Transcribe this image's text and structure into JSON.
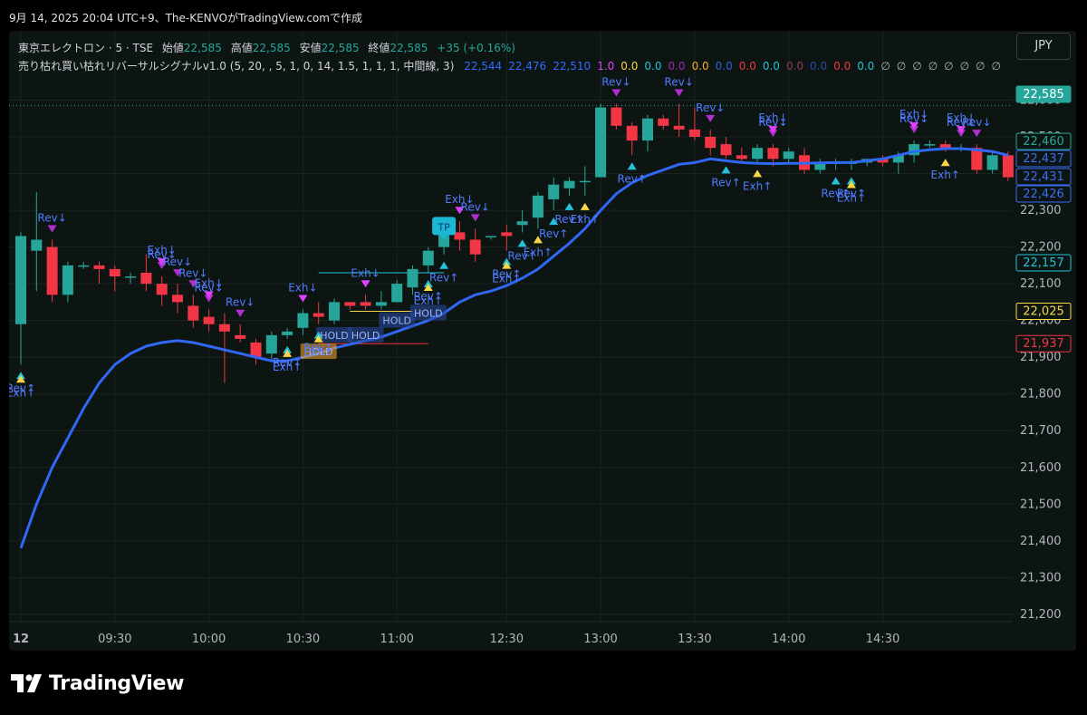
{
  "snapshot_line": "9月 14, 2025 20:04 UTC+9、The-KENVOがTradingView.comで作成",
  "currency_button": "JPY",
  "legend": {
    "symbol": "東京エレクトロン · 5 · TSE",
    "open_label": "始値",
    "open_value": "22,585",
    "high_label": "高値",
    "high_value": "22,585",
    "low_label": "安値",
    "low_value": "22,585",
    "close_label": "終値",
    "close_value": "22,585",
    "change": "+35 (+0.16%)",
    "indicator_name": "売り枯れ買い枯れリバーサルシグナルv1.0 (5, 20, , 5, 1, 0, 14, 1.5, 1, 1, 1, 中間線, 3)",
    "indicator_values": [
      {
        "text": "22,544",
        "color": "#2f6bff"
      },
      {
        "text": "22,476",
        "color": "#2f6bff"
      },
      {
        "text": "22,510",
        "color": "#2f6bff"
      },
      {
        "text": "1.0",
        "color": "#e040fb"
      },
      {
        "text": "0.0",
        "color": "#f9d648"
      },
      {
        "text": "0.0",
        "color": "#22c3d6"
      },
      {
        "text": "0.0",
        "color": "#9c27b0"
      },
      {
        "text": "0.0",
        "color": "#ffa726"
      },
      {
        "text": "0.0",
        "color": "#2f5fd8"
      },
      {
        "text": "0.0",
        "color": "#f23645"
      },
      {
        "text": "0.0",
        "color": "#22c3d6"
      },
      {
        "text": "0.0",
        "color": "#8e3a5a"
      },
      {
        "text": "0.0",
        "color": "#2a4aa0"
      },
      {
        "text": "0.0",
        "color": "#f23645"
      },
      {
        "text": "0.0",
        "color": "#22c3d6"
      },
      {
        "text": "∅",
        "color": "#b2b5be"
      },
      {
        "text": "∅",
        "color": "#b2b5be"
      },
      {
        "text": "∅",
        "color": "#b2b5be"
      },
      {
        "text": "∅",
        "color": "#b2b5be"
      },
      {
        "text": "∅",
        "color": "#b2b5be"
      },
      {
        "text": "∅",
        "color": "#b2b5be"
      },
      {
        "text": "∅",
        "color": "#b2b5be"
      },
      {
        "text": "∅",
        "color": "#b2b5be"
      }
    ]
  },
  "footer_brand": "TradingView",
  "colors": {
    "up": "#26a69a",
    "down": "#f23645",
    "ma_line": "#3068f5",
    "background": "#0d1513",
    "grid": "#1b2421",
    "signal_up": "#22c3d6",
    "signal_down": "#b02fd0",
    "signal_exh_up": "#f9d648",
    "signal_exh_down": "#e040fb",
    "label_text": "#4f7cff"
  },
  "chart_data": {
    "type": "candlestick",
    "symbol": "東京エレクトロン",
    "interval": "5",
    "x_tick_labels": [
      "12",
      "09:30",
      "10:00",
      "10:30",
      "11:00",
      "12:30",
      "13:00",
      "13:30",
      "14:00",
      "14:30"
    ],
    "x_tick_index": [
      0,
      6,
      12,
      18,
      24,
      31,
      37,
      43,
      49,
      55
    ],
    "y_ticks": [
      21200,
      21300,
      21400,
      21500,
      21600,
      21700,
      21800,
      21900,
      22000,
      22100,
      22200,
      22300,
      22400,
      22500,
      22600
    ],
    "ylim": [
      21180,
      22690
    ],
    "grid": true,
    "candles": [
      {
        "o": 21990,
        "h": 22240,
        "l": 21880,
        "c": 22230
      },
      {
        "o": 22190,
        "h": 22350,
        "l": 22080,
        "c": 22220
      },
      {
        "o": 22200,
        "h": 22220,
        "l": 22050,
        "c": 22070
      },
      {
        "o": 22070,
        "h": 22160,
        "l": 22050,
        "c": 22150
      },
      {
        "o": 22150,
        "h": 22160,
        "l": 22140,
        "c": 22150
      },
      {
        "o": 22150,
        "h": 22160,
        "l": 22100,
        "c": 22140
      },
      {
        "o": 22140,
        "h": 22150,
        "l": 22080,
        "c": 22120
      },
      {
        "o": 22120,
        "h": 22130,
        "l": 22100,
        "c": 22120
      },
      {
        "o": 22130,
        "h": 22180,
        "l": 22080,
        "c": 22100
      },
      {
        "o": 22100,
        "h": 22120,
        "l": 22040,
        "c": 22070
      },
      {
        "o": 22070,
        "h": 22100,
        "l": 22020,
        "c": 22050
      },
      {
        "o": 22040,
        "h": 22070,
        "l": 21980,
        "c": 22000
      },
      {
        "o": 22010,
        "h": 22030,
        "l": 21970,
        "c": 21990
      },
      {
        "o": 21990,
        "h": 22020,
        "l": 21830,
        "c": 21970
      },
      {
        "o": 21960,
        "h": 21990,
        "l": 21940,
        "c": 21950
      },
      {
        "o": 21940,
        "h": 21950,
        "l": 21880,
        "c": 21900
      },
      {
        "o": 21910,
        "h": 21970,
        "l": 21890,
        "c": 21960
      },
      {
        "o": 21960,
        "h": 21980,
        "l": 21950,
        "c": 21970
      },
      {
        "o": 21980,
        "h": 22030,
        "l": 21960,
        "c": 22020
      },
      {
        "o": 22020,
        "h": 22050,
        "l": 21990,
        "c": 22010
      },
      {
        "o": 22000,
        "h": 22060,
        "l": 21990,
        "c": 22050
      },
      {
        "o": 22050,
        "h": 22050,
        "l": 22030,
        "c": 22040
      },
      {
        "o": 22050,
        "h": 22070,
        "l": 22030,
        "c": 22040
      },
      {
        "o": 22040,
        "h": 22080,
        "l": 22030,
        "c": 22050
      },
      {
        "o": 22050,
        "h": 22110,
        "l": 22050,
        "c": 22100
      },
      {
        "o": 22090,
        "h": 22150,
        "l": 22070,
        "c": 22140
      },
      {
        "o": 22150,
        "h": 22200,
        "l": 22130,
        "c": 22190
      },
      {
        "o": 22200,
        "h": 22260,
        "l": 22180,
        "c": 22250
      },
      {
        "o": 22240,
        "h": 22270,
        "l": 22190,
        "c": 22220
      },
      {
        "o": 22220,
        "h": 22250,
        "l": 22160,
        "c": 22180
      },
      {
        "o": 22230,
        "h": 22230,
        "l": 22220,
        "c": 22230
      },
      {
        "o": 22240,
        "h": 22260,
        "l": 22190,
        "c": 22230
      },
      {
        "o": 22260,
        "h": 22300,
        "l": 22240,
        "c": 22270
      },
      {
        "o": 22280,
        "h": 22350,
        "l": 22250,
        "c": 22340
      },
      {
        "o": 22330,
        "h": 22390,
        "l": 22300,
        "c": 22370
      },
      {
        "o": 22360,
        "h": 22390,
        "l": 22340,
        "c": 22380
      },
      {
        "o": 22380,
        "h": 22420,
        "l": 22340,
        "c": 22380
      },
      {
        "o": 22390,
        "h": 22590,
        "l": 22390,
        "c": 22580
      },
      {
        "o": 22580,
        "h": 22590,
        "l": 22520,
        "c": 22530
      },
      {
        "o": 22530,
        "h": 22540,
        "l": 22450,
        "c": 22490
      },
      {
        "o": 22490,
        "h": 22560,
        "l": 22460,
        "c": 22550
      },
      {
        "o": 22550,
        "h": 22560,
        "l": 22520,
        "c": 22530
      },
      {
        "o": 22530,
        "h": 22590,
        "l": 22500,
        "c": 22520
      },
      {
        "o": 22520,
        "h": 22580,
        "l": 22490,
        "c": 22500
      },
      {
        "o": 22500,
        "h": 22520,
        "l": 22450,
        "c": 22470
      },
      {
        "o": 22480,
        "h": 22500,
        "l": 22440,
        "c": 22450
      },
      {
        "o": 22450,
        "h": 22470,
        "l": 22430,
        "c": 22440
      },
      {
        "o": 22440,
        "h": 22480,
        "l": 22430,
        "c": 22470
      },
      {
        "o": 22470,
        "h": 22480,
        "l": 22420,
        "c": 22440
      },
      {
        "o": 22440,
        "h": 22470,
        "l": 22430,
        "c": 22460
      },
      {
        "o": 22450,
        "h": 22470,
        "l": 22400,
        "c": 22410
      },
      {
        "o": 22410,
        "h": 22440,
        "l": 22400,
        "c": 22430
      },
      {
        "o": 22430,
        "h": 22440,
        "l": 22410,
        "c": 22430
      },
      {
        "o": 22430,
        "h": 22440,
        "l": 22410,
        "c": 22430
      },
      {
        "o": 22430,
        "h": 22440,
        "l": 22420,
        "c": 22440
      },
      {
        "o": 22440,
        "h": 22450,
        "l": 22420,
        "c": 22430
      },
      {
        "o": 22430,
        "h": 22460,
        "l": 22400,
        "c": 22450
      },
      {
        "o": 22450,
        "h": 22490,
        "l": 22430,
        "c": 22480
      },
      {
        "o": 22480,
        "h": 22490,
        "l": 22470,
        "c": 22480
      },
      {
        "o": 22480,
        "h": 22490,
        "l": 22460,
        "c": 22470
      },
      {
        "o": 22470,
        "h": 22480,
        "l": 22460,
        "c": 22470
      },
      {
        "o": 22470,
        "h": 22480,
        "l": 22400,
        "c": 22410
      },
      {
        "o": 22410,
        "h": 22460,
        "l": 22400,
        "c": 22450
      },
      {
        "o": 22450,
        "h": 22460,
        "l": 22380,
        "c": 22390
      }
    ],
    "ma_line": [
      21380,
      21500,
      21600,
      21680,
      21760,
      21830,
      21880,
      21910,
      21930,
      21940,
      21945,
      21940,
      21930,
      21920,
      21910,
      21900,
      21890,
      21890,
      21900,
      21910,
      21925,
      21935,
      21945,
      21955,
      21970,
      21985,
      22000,
      22020,
      22050,
      22070,
      22080,
      22095,
      22115,
      22140,
      22175,
      22210,
      22250,
      22300,
      22345,
      22375,
      22395,
      22410,
      22425,
      22430,
      22440,
      22435,
      22430,
      22428,
      22427,
      22428,
      22428,
      22429,
      22430,
      22430,
      22435,
      22440,
      22450,
      22460,
      22465,
      22468,
      22468,
      22465,
      22460,
      22450
    ],
    "signals": [
      {
        "i": 0,
        "text": "Rev↑",
        "side": "below",
        "kind": "rev_up"
      },
      {
        "i": 0,
        "text": "Exh↑",
        "side": "below",
        "kind": "exh_up"
      },
      {
        "i": 2,
        "text": "Rev↓",
        "side": "above",
        "kind": "rev_down"
      },
      {
        "i": 9,
        "text": "Rev↓",
        "side": "above",
        "kind": "rev_down"
      },
      {
        "i": 9,
        "text": "Exh↓",
        "side": "above",
        "kind": "exh_down"
      },
      {
        "i": 10,
        "text": "Rev↓",
        "side": "above",
        "kind": "rev_down"
      },
      {
        "i": 11,
        "text": "Rev↓",
        "side": "above",
        "kind": "rev_down"
      },
      {
        "i": 12,
        "text": "Rev↓",
        "side": "above",
        "kind": "rev_down"
      },
      {
        "i": 12,
        "text": "Exh↓",
        "side": "above",
        "kind": "exh_down"
      },
      {
        "i": 14,
        "text": "Rev↓",
        "side": "above",
        "kind": "rev_down"
      },
      {
        "i": 17,
        "text": "Rev↑",
        "side": "below",
        "kind": "rev_up"
      },
      {
        "i": 17,
        "text": "Exh↑",
        "side": "below",
        "kind": "exh_up"
      },
      {
        "i": 18,
        "text": "Exh↓",
        "side": "above",
        "kind": "exh_down"
      },
      {
        "i": 19,
        "text": "Rev↑",
        "side": "below",
        "kind": "rev_up"
      },
      {
        "i": 19,
        "text": "Exh↑",
        "side": "below",
        "kind": "exh_up"
      },
      {
        "i": 22,
        "text": "Exh↓",
        "side": "above",
        "kind": "exh_down"
      },
      {
        "i": 26,
        "text": "Rev↑",
        "side": "below",
        "kind": "rev_up"
      },
      {
        "i": 26,
        "text": "Exh↑",
        "side": "below",
        "kind": "exh_up"
      },
      {
        "i": 27,
        "text": "Rev↑",
        "side": "below",
        "kind": "rev_up"
      },
      {
        "i": 28,
        "text": "Exh↓",
        "side": "above",
        "kind": "exh_down"
      },
      {
        "i": 29,
        "text": "Rev↓",
        "side": "above",
        "kind": "rev_down"
      },
      {
        "i": 31,
        "text": "Rev↑",
        "side": "below",
        "kind": "rev_up"
      },
      {
        "i": 31,
        "text": "Exh↑",
        "side": "below",
        "kind": "exh_up"
      },
      {
        "i": 32,
        "text": "Rev↑",
        "side": "below",
        "kind": "rev_up"
      },
      {
        "i": 33,
        "text": "Exh↑",
        "side": "below",
        "kind": "exh_up"
      },
      {
        "i": 34,
        "text": "Rev↑",
        "side": "below",
        "kind": "rev_up"
      },
      {
        "i": 35,
        "text": "Rev↑",
        "side": "below",
        "kind": "rev_up"
      },
      {
        "i": 36,
        "text": "Exh↑",
        "side": "below",
        "kind": "exh_up"
      },
      {
        "i": 38,
        "text": "Rev↓",
        "side": "above",
        "kind": "rev_down"
      },
      {
        "i": 39,
        "text": "Rev↑",
        "side": "below",
        "kind": "rev_up"
      },
      {
        "i": 42,
        "text": "Rev↓",
        "side": "above",
        "kind": "rev_down"
      },
      {
        "i": 44,
        "text": "Rev↓",
        "side": "above",
        "kind": "rev_down"
      },
      {
        "i": 45,
        "text": "Rev↑",
        "side": "below",
        "kind": "rev_up"
      },
      {
        "i": 47,
        "text": "Exh↑",
        "side": "below",
        "kind": "exh_up"
      },
      {
        "i": 48,
        "text": "Rev↓",
        "side": "above",
        "kind": "rev_down"
      },
      {
        "i": 48,
        "text": "Exh↓",
        "side": "above",
        "kind": "exh_down"
      },
      {
        "i": 52,
        "text": "Rev↑",
        "side": "below",
        "kind": "rev_up"
      },
      {
        "i": 53,
        "text": "Rev↑",
        "side": "below",
        "kind": "rev_up"
      },
      {
        "i": 53,
        "text": "Exh↑",
        "side": "below",
        "kind": "exh_up"
      },
      {
        "i": 57,
        "text": "Rev↓",
        "side": "above",
        "kind": "rev_down"
      },
      {
        "i": 57,
        "text": "Exh↓",
        "side": "above",
        "kind": "exh_down"
      },
      {
        "i": 59,
        "text": "Exh↑",
        "side": "below",
        "kind": "exh_up"
      },
      {
        "i": 60,
        "text": "Rev↓",
        "side": "above",
        "kind": "rev_down"
      },
      {
        "i": 60,
        "text": "Exh↓",
        "side": "above",
        "kind": "exh_down"
      },
      {
        "i": 61,
        "text": "Rev↓",
        "side": "above",
        "kind": "rev_down"
      }
    ],
    "hold_labels": [
      {
        "i": 19,
        "y": 21915,
        "text": "HOLD",
        "color": "#ffa726"
      },
      {
        "i": 20,
        "y": 21960,
        "text": "HOLD",
        "color": "#2a4aa0"
      },
      {
        "i": 22,
        "y": 21960,
        "text": "HOLD",
        "color": "#2a4aa0"
      },
      {
        "i": 24,
        "y": 22000,
        "text": "HOLD",
        "color": "#2a4aa0"
      },
      {
        "i": 26,
        "y": 22020,
        "text": "HOLD",
        "color": "#2a4aa0"
      }
    ],
    "tp_label": {
      "i": 27,
      "y": 22230,
      "text": "TP"
    },
    "horizontal_levels": [
      {
        "from": 19,
        "to": 27,
        "y": 22130,
        "color": "#22c3d6"
      },
      {
        "from": 19,
        "to": 26,
        "y": 21937,
        "color": "#f23645"
      },
      {
        "from": 21,
        "to": 25,
        "y": 22025,
        "color": "#f9d648"
      }
    ],
    "price_tags": [
      {
        "value": "22,585",
        "y": 22585,
        "bg": "#26a69a",
        "fg": "#ffffff",
        "border": "#26a69a"
      },
      {
        "value": "22,460",
        "y": 22460,
        "bg": "#0d1513",
        "fg": "#26a69a",
        "border": "#26a69a"
      },
      {
        "value": "22,437",
        "y": 22437,
        "bg": "#0d1513",
        "fg": "#3c6cf0",
        "border": "#3c6cf0"
      },
      {
        "value": "22,431",
        "y": 22431,
        "bg": "#0d1513",
        "fg": "#3c6cf0",
        "border": "#3c6cf0"
      },
      {
        "value": "22,426",
        "y": 22426,
        "bg": "#0d1513",
        "fg": "#3c6cf0",
        "border": "#3c6cf0"
      },
      {
        "value": "22,157",
        "y": 22157,
        "bg": "#0d1513",
        "fg": "#22c3d6",
        "border": "#22c3d6"
      },
      {
        "value": "22,025",
        "y": 22025,
        "bg": "#0d1513",
        "fg": "#f9d648",
        "border": "#f9d648"
      },
      {
        "value": "21,937",
        "y": 21937,
        "bg": "#0d1513",
        "fg": "#f23645",
        "border": "#f23645"
      }
    ]
  }
}
